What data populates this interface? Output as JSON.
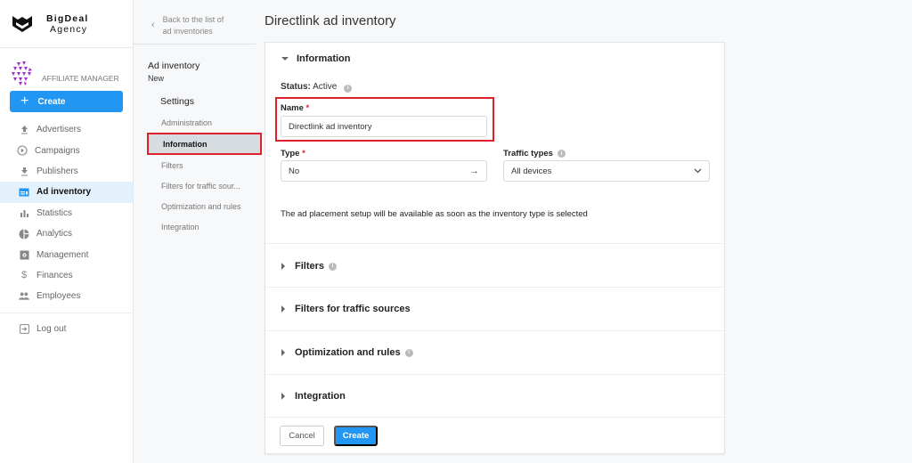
{
  "brand": {
    "line1": "BigDeal",
    "line2": "Agency"
  },
  "user": {
    "role": "AFFILIATE MANAGER"
  },
  "sidebar": {
    "create_label": "Create",
    "items": [
      {
        "label": "Advertisers",
        "icon": "upload-icon"
      },
      {
        "label": "Campaigns",
        "icon": "play-circle-icon"
      },
      {
        "label": "Publishers",
        "icon": "download-icon"
      },
      {
        "label": "Ad inventory",
        "icon": "ad-inventory-icon",
        "active": true
      },
      {
        "label": "Statistics",
        "icon": "bar-chart-icon"
      },
      {
        "label": "Analytics",
        "icon": "pie-chart-icon"
      },
      {
        "label": "Management",
        "icon": "settings-box-icon"
      },
      {
        "label": "Finances",
        "icon": "dollar-icon"
      },
      {
        "label": "Employees",
        "icon": "people-icon"
      }
    ],
    "logout_label": "Log out"
  },
  "subnav": {
    "back_line1": "Back to the list of",
    "back_line2": "ad inventories",
    "title": "Ad inventory",
    "subtitle": "New",
    "settings_label": "Settings",
    "items": [
      {
        "label": "Administration"
      },
      {
        "label": "Information",
        "active": true
      },
      {
        "label": "Filters"
      },
      {
        "label": "Filters for traffic sour..."
      },
      {
        "label": "Optimization and rules"
      },
      {
        "label": "Integration"
      }
    ]
  },
  "main": {
    "page_title": "Directlink ad inventory",
    "information": {
      "heading": "Information",
      "status_label": "Status:",
      "status_value": "Active",
      "name_label": "Name",
      "name_value": "Directlink ad inventory",
      "type_label": "Type",
      "type_value": "No",
      "traffic_label": "Traffic types",
      "traffic_value": "All devices",
      "note": "The ad placement setup will be available as soon as the inventory type is selected",
      "required_mark": "*"
    },
    "sections": [
      {
        "label": "Filters",
        "info": true
      },
      {
        "label": "Filters for traffic sources",
        "info": false
      },
      {
        "label": "Optimization and rules",
        "info": true
      },
      {
        "label": "Integration",
        "info": false
      }
    ],
    "cancel_label": "Cancel",
    "create_label": "Create"
  },
  "colors": {
    "accent": "#2196f3",
    "highlight": "#e0202a",
    "active_nav_bg": "#e3f1fc"
  }
}
